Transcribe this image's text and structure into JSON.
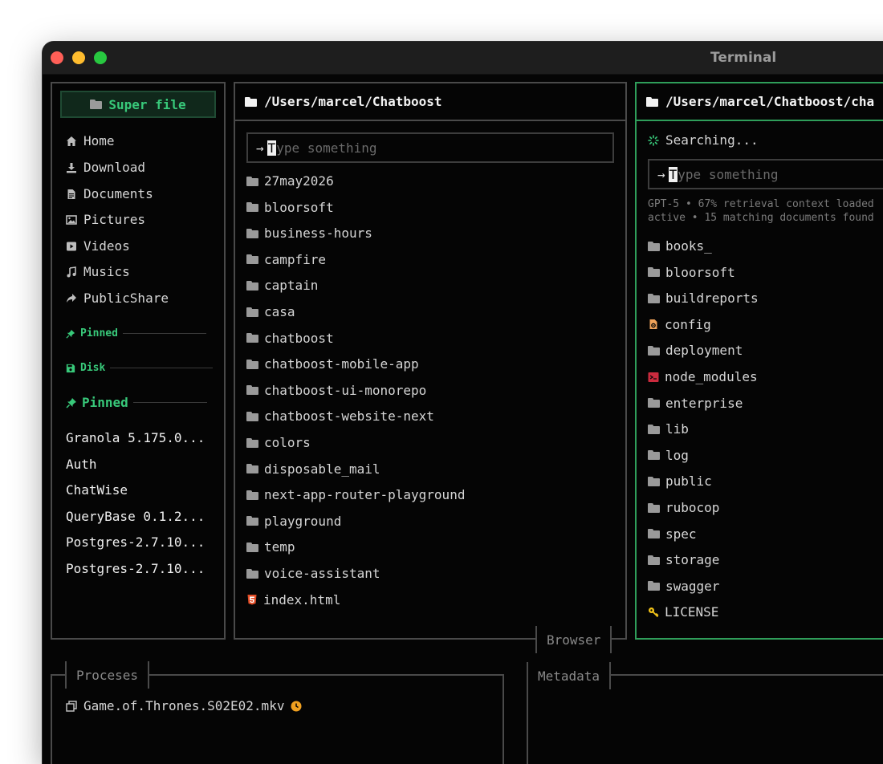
{
  "window": {
    "title": "Terminal"
  },
  "sidebar": {
    "app_title": "Super file",
    "items": [
      {
        "label": "Home",
        "icon": "home-icon"
      },
      {
        "label": "Download",
        "icon": "download-icon"
      },
      {
        "label": "Documents",
        "icon": "document-icon"
      },
      {
        "label": "Pictures",
        "icon": "picture-icon"
      },
      {
        "label": "Videos",
        "icon": "video-icon"
      },
      {
        "label": "Musics",
        "icon": "music-icon"
      },
      {
        "label": "PublicShare",
        "icon": "share-icon"
      }
    ],
    "section_pinned_small": "Pinned",
    "section_disk": "Disk",
    "section_pinned": "Pinned",
    "pinned": [
      "Granola 5.175.0...",
      "Auth",
      "ChatWise",
      "QueryBase 0.1.2...",
      "Postgres-2.7.10...",
      "Postgres-2.7.10..."
    ]
  },
  "browser": {
    "path": "/Users/marcel/Chatboost",
    "input_arrow": "→",
    "input_cursor": "T",
    "input_placeholder": "ype something",
    "files": [
      {
        "name": "27may2026",
        "type": "folder"
      },
      {
        "name": "bloorsoft",
        "type": "folder"
      },
      {
        "name": "business-hours",
        "type": "folder"
      },
      {
        "name": "campfire",
        "type": "folder"
      },
      {
        "name": "captain",
        "type": "folder"
      },
      {
        "name": "casa",
        "type": "folder"
      },
      {
        "name": "chatboost",
        "type": "folder"
      },
      {
        "name": "chatboost-mobile-app",
        "type": "folder"
      },
      {
        "name": "chatboost-ui-monorepo",
        "type": "folder"
      },
      {
        "name": "chatboost-website-next",
        "type": "folder"
      },
      {
        "name": "colors",
        "type": "folder"
      },
      {
        "name": "disposable_mail",
        "type": "folder"
      },
      {
        "name": "next-app-router-playground",
        "type": "folder"
      },
      {
        "name": "playground",
        "type": "folder"
      },
      {
        "name": "temp",
        "type": "folder"
      },
      {
        "name": "voice-assistant",
        "type": "folder"
      },
      {
        "name": "index.html",
        "type": "html"
      }
    ],
    "tab_label": "Browser"
  },
  "right": {
    "path": "/Users/marcel/Chatboost/cha",
    "status": "Searching...",
    "input_arrow": "→",
    "input_cursor": "T",
    "input_placeholder": "ype something",
    "meta_line1": "GPT-5 • 67% retrieval context loaded",
    "meta_line2": "active • 15 matching documents found",
    "files": [
      {
        "name": "books_",
        "type": "folder"
      },
      {
        "name": "bloorsoft",
        "type": "folder"
      },
      {
        "name": "buildreports",
        "type": "folder"
      },
      {
        "name": "config",
        "type": "config"
      },
      {
        "name": "deployment",
        "type": "folder"
      },
      {
        "name": "node_modules",
        "type": "npm"
      },
      {
        "name": "enterprise",
        "type": "folder"
      },
      {
        "name": "lib",
        "type": "folder"
      },
      {
        "name": "log",
        "type": "folder"
      },
      {
        "name": "public",
        "type": "folder"
      },
      {
        "name": "rubocop",
        "type": "folder"
      },
      {
        "name": "spec",
        "type": "folder"
      },
      {
        "name": "storage",
        "type": "folder"
      },
      {
        "name": "swagger",
        "type": "folder"
      },
      {
        "name": "LICENSE",
        "type": "license"
      }
    ]
  },
  "bottom": {
    "processes_label": "Proceses",
    "process_item": "Game.of.Thrones.S02E02.mkv",
    "metadata_label": "Metadata"
  },
  "colors": {
    "accent": "#38c97a",
    "border": "#4a4a4a",
    "active_border": "#2f9e5a"
  }
}
